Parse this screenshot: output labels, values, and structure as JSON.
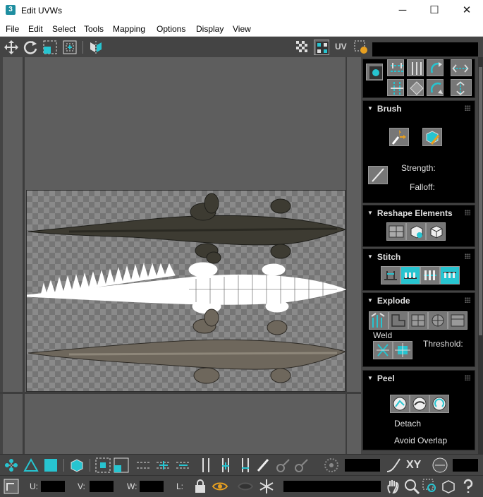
{
  "window": {
    "title": "Edit UVWs",
    "icon_label": "3",
    "minimize": "─",
    "maximize": "☐",
    "close": "✕"
  },
  "menu": [
    "File",
    "Edit",
    "Select",
    "Tools",
    "Mapping",
    "Options",
    "Display",
    "View"
  ],
  "toolbar": {
    "uv_label": "UV"
  },
  "panel": {
    "brush": {
      "title": "Brush",
      "strength_label": "Strength:",
      "falloff_label": "Falloff:"
    },
    "reshape": {
      "title": "Reshape Elements"
    },
    "stitch": {
      "title": "Stitch"
    },
    "explode": {
      "title": "Explode",
      "weld_label": "Weld",
      "threshold_label": "Threshold:"
    },
    "peel": {
      "title": "Peel",
      "detach_label": "Detach",
      "avoid_overlap_label": "Avoid Overlap"
    }
  },
  "bottom": {
    "xy_label": "XY",
    "u_label": "U:",
    "v_label": "V:",
    "w_label": "W:",
    "l_label": "L:"
  },
  "colors": {
    "accent": "#27c4d0",
    "viewport": "#5e5e5e",
    "panel": "#000000"
  }
}
